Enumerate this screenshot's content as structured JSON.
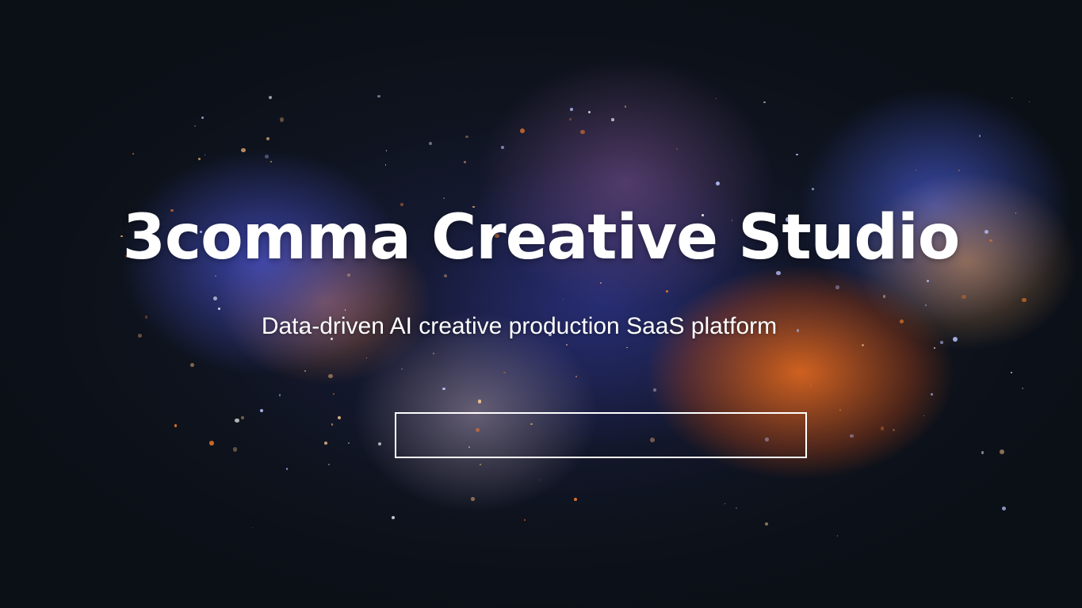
{
  "hero": {
    "title": "3comma Creative Studio",
    "subtitle": "Data-driven AI creative production SaaS platform",
    "cta_label": ""
  },
  "colors": {
    "text": "#ffffff",
    "background": "#0b0f16",
    "accent_orange": "#f06e1e",
    "accent_blue": "#4650c8"
  }
}
